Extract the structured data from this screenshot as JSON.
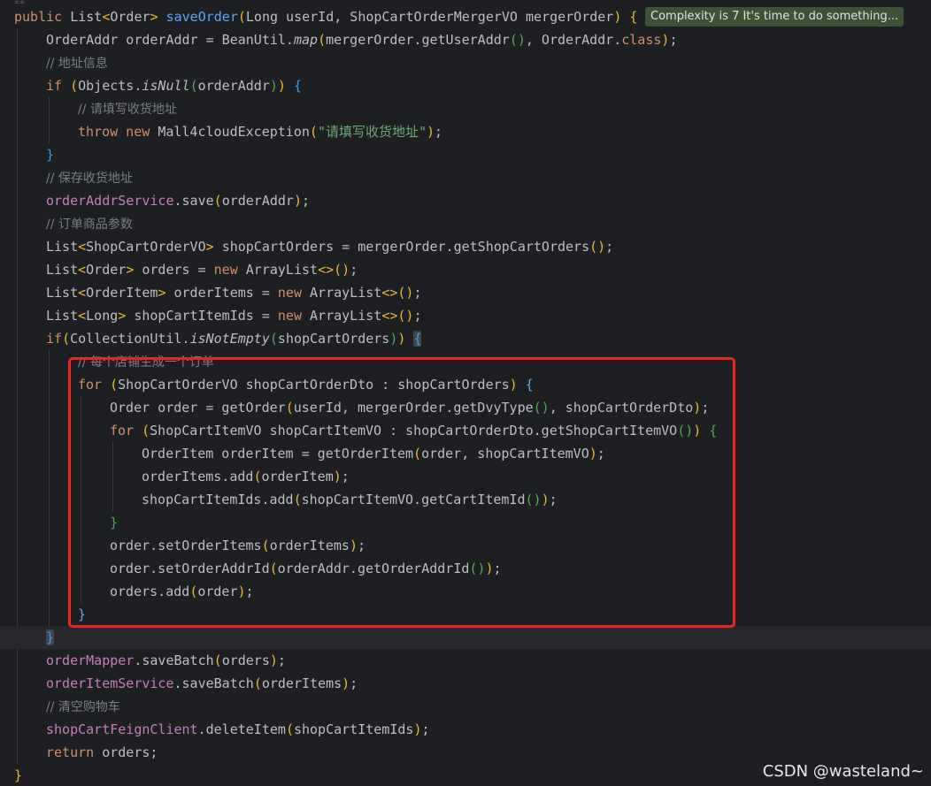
{
  "editor": {
    "top_glyph": "⁂",
    "complexity_hint": "Complexity is 7 It's time to do something...",
    "watermark": "CSDN @wasteland~",
    "highlight_color": "#e8261f",
    "lines": [
      {
        "indent": 0,
        "tokens": [
          [
            "kw",
            "public "
          ],
          [
            "",
            "List"
          ],
          [
            "b1",
            "<"
          ],
          [
            "",
            "Order"
          ],
          [
            "b1",
            "> "
          ],
          [
            "fn",
            "saveOrder"
          ],
          [
            "b1",
            "("
          ],
          [
            "",
            "Long userId, ShopCartOrderMergerVO mergerOrder"
          ],
          [
            "b1",
            ") {"
          ]
        ]
      },
      {
        "indent": 1,
        "tokens": [
          [
            "",
            "OrderAddr orderAddr = BeanUtil."
          ],
          [
            "it",
            "map"
          ],
          [
            "b1",
            "("
          ],
          [
            "",
            "mergerOrder.getUserAddr"
          ],
          [
            "b2",
            "()"
          ],
          [
            "",
            ", OrderAddr."
          ],
          [
            "kw",
            "class"
          ],
          [
            "b1",
            ")"
          ],
          [
            "",
            ";"
          ]
        ]
      },
      {
        "indent": 1,
        "tokens": [
          [
            "cm",
            "// 地址信息"
          ]
        ]
      },
      {
        "indent": 1,
        "tokens": [
          [
            "kw",
            "if "
          ],
          [
            "b1",
            "("
          ],
          [
            "",
            "Objects."
          ],
          [
            "it",
            "isNull"
          ],
          [
            "b2",
            "("
          ],
          [
            "",
            "orderAddr"
          ],
          [
            "b2",
            ")"
          ],
          [
            "b1",
            ") "
          ],
          [
            "b3",
            "{"
          ]
        ]
      },
      {
        "indent": 2,
        "tokens": [
          [
            "cm",
            "// 请填写收货地址"
          ]
        ]
      },
      {
        "indent": 2,
        "tokens": [
          [
            "kw",
            "throw new "
          ],
          [
            "",
            "Mall4cloudException"
          ],
          [
            "b1",
            "("
          ],
          [
            "str",
            "\"请填写收货地址\""
          ],
          [
            "b1",
            ")"
          ],
          [
            "",
            ";"
          ]
        ]
      },
      {
        "indent": 1,
        "tokens": [
          [
            "b3",
            "}"
          ]
        ]
      },
      {
        "indent": 1,
        "tokens": [
          [
            "cm",
            "// 保存收货地址"
          ]
        ]
      },
      {
        "indent": 1,
        "tokens": [
          [
            "fld",
            "orderAddrService"
          ],
          [
            "",
            ".save"
          ],
          [
            "b1",
            "("
          ],
          [
            "",
            "orderAddr"
          ],
          [
            "b1",
            ")"
          ],
          [
            "",
            ";"
          ]
        ]
      },
      {
        "indent": 1,
        "tokens": [
          [
            "cm",
            "// 订单商品参数"
          ]
        ]
      },
      {
        "indent": 1,
        "tokens": [
          [
            "",
            "List"
          ],
          [
            "b1",
            "<"
          ],
          [
            "",
            "ShopCartOrderVO"
          ],
          [
            "b1",
            "> "
          ],
          [
            "",
            "shopCartOrders = mergerOrder.getShopCartOrders"
          ],
          [
            "b1",
            "()"
          ],
          [
            "",
            ";"
          ]
        ]
      },
      {
        "indent": 1,
        "tokens": [
          [
            "",
            "List"
          ],
          [
            "b1",
            "<"
          ],
          [
            "",
            "Order"
          ],
          [
            "b1",
            "> "
          ],
          [
            "",
            "orders = "
          ],
          [
            "kw",
            "new "
          ],
          [
            "",
            "ArrayList"
          ],
          [
            "b1",
            "<>()"
          ],
          [
            "",
            ";"
          ]
        ]
      },
      {
        "indent": 1,
        "tokens": [
          [
            "",
            "List"
          ],
          [
            "b1",
            "<"
          ],
          [
            "",
            "OrderItem"
          ],
          [
            "b1",
            "> "
          ],
          [
            "",
            "orderItems = "
          ],
          [
            "kw",
            "new "
          ],
          [
            "",
            "ArrayList"
          ],
          [
            "b1",
            "<>()"
          ],
          [
            "",
            ";"
          ]
        ]
      },
      {
        "indent": 1,
        "tokens": [
          [
            "",
            "List"
          ],
          [
            "b1",
            "<"
          ],
          [
            "",
            "Long"
          ],
          [
            "b1",
            "> "
          ],
          [
            "",
            "shopCartItemIds = "
          ],
          [
            "kw",
            "new "
          ],
          [
            "",
            "ArrayList"
          ],
          [
            "b1",
            "<>()"
          ],
          [
            "",
            ";"
          ]
        ]
      },
      {
        "indent": 1,
        "tokens": [
          [
            "kw",
            "if"
          ],
          [
            "b1",
            "("
          ],
          [
            "",
            "CollectionUtil."
          ],
          [
            "it",
            "isNotEmpty"
          ],
          [
            "b2",
            "("
          ],
          [
            "",
            "shopCartOrders"
          ],
          [
            "b2",
            ")"
          ],
          [
            "b1",
            ") "
          ],
          [
            "b3 match",
            "{"
          ]
        ]
      },
      {
        "indent": 2,
        "tokens": [
          [
            "cm",
            "// 每个店铺生成一个订单"
          ]
        ]
      },
      {
        "indent": 2,
        "tokens": [
          [
            "kw",
            "for "
          ],
          [
            "b1",
            "("
          ],
          [
            "",
            "ShopCartOrderVO shopCartOrderDto : shopCartOrders"
          ],
          [
            "b1",
            ") "
          ],
          [
            "b4",
            "{"
          ]
        ]
      },
      {
        "indent": 3,
        "tokens": [
          [
            "",
            "Order order = getOrder"
          ],
          [
            "b1",
            "("
          ],
          [
            "",
            "userId, mergerOrder.getDvyType"
          ],
          [
            "b2",
            "()"
          ],
          [
            "",
            ", shopCartOrderDto"
          ],
          [
            "b1",
            ")"
          ],
          [
            "",
            ";"
          ]
        ]
      },
      {
        "indent": 3,
        "tokens": [
          [
            "kw",
            "for "
          ],
          [
            "b1",
            "("
          ],
          [
            "",
            "ShopCartItemVO shopCartItemVO : shopCartOrderDto.getShopCartItemVO"
          ],
          [
            "b2",
            "()"
          ],
          [
            "b1",
            ") "
          ],
          [
            "b2",
            "{"
          ]
        ]
      },
      {
        "indent": 4,
        "tokens": [
          [
            "",
            "OrderItem orderItem = getOrderItem"
          ],
          [
            "b1",
            "("
          ],
          [
            "",
            "order, shopCartItemVO"
          ],
          [
            "b1",
            ")"
          ],
          [
            "",
            ";"
          ]
        ]
      },
      {
        "indent": 4,
        "tokens": [
          [
            "",
            "orderItems.add"
          ],
          [
            "b1",
            "("
          ],
          [
            "",
            "orderItem"
          ],
          [
            "b1",
            ")"
          ],
          [
            "",
            ";"
          ]
        ]
      },
      {
        "indent": 4,
        "tokens": [
          [
            "",
            "shopCartItemIds.add"
          ],
          [
            "b1",
            "("
          ],
          [
            "",
            "shopCartItemVO.getCartItemId"
          ],
          [
            "b2",
            "()"
          ],
          [
            "b1",
            ")"
          ],
          [
            "",
            ";"
          ]
        ]
      },
      {
        "indent": 3,
        "tokens": [
          [
            "b2",
            "}"
          ]
        ]
      },
      {
        "indent": 3,
        "tokens": [
          [
            "",
            "order.setOrderItems"
          ],
          [
            "b1",
            "("
          ],
          [
            "",
            "orderItems"
          ],
          [
            "b1",
            ")"
          ],
          [
            "",
            ";"
          ]
        ]
      },
      {
        "indent": 3,
        "tokens": [
          [
            "",
            "order.setOrderAddrId"
          ],
          [
            "b1",
            "("
          ],
          [
            "",
            "orderAddr.getOrderAddrId"
          ],
          [
            "b2",
            "()"
          ],
          [
            "b1",
            ")"
          ],
          [
            "",
            ";"
          ]
        ]
      },
      {
        "indent": 3,
        "tokens": [
          [
            "",
            "orders.add"
          ],
          [
            "b1",
            "("
          ],
          [
            "",
            "order"
          ],
          [
            "b1",
            ")"
          ],
          [
            "",
            ";"
          ]
        ]
      },
      {
        "indent": 2,
        "tokens": [
          [
            "b4",
            "}"
          ]
        ]
      },
      {
        "indent": 1,
        "tokens": [
          [
            "b3 match",
            "}"
          ]
        ],
        "current": true
      },
      {
        "indent": 1,
        "tokens": [
          [
            "fld",
            "orderMapper"
          ],
          [
            "",
            ".saveBatch"
          ],
          [
            "b1",
            "("
          ],
          [
            "",
            "orders"
          ],
          [
            "b1",
            ")"
          ],
          [
            "",
            ";"
          ]
        ]
      },
      {
        "indent": 1,
        "tokens": [
          [
            "fld",
            "orderItemService"
          ],
          [
            "",
            ".saveBatch"
          ],
          [
            "b1",
            "("
          ],
          [
            "",
            "orderItems"
          ],
          [
            "b1",
            ")"
          ],
          [
            "",
            ";"
          ]
        ]
      },
      {
        "indent": 1,
        "tokens": [
          [
            "cm",
            "// 清空购物车"
          ]
        ]
      },
      {
        "indent": 1,
        "tokens": [
          [
            "fld",
            "shopCartFeignClient"
          ],
          [
            "",
            ".deleteItem"
          ],
          [
            "b1",
            "("
          ],
          [
            "",
            "shopCartItemIds"
          ],
          [
            "b1",
            ")"
          ],
          [
            "",
            ";"
          ]
        ]
      },
      {
        "indent": 1,
        "tokens": [
          [
            "kw",
            "return "
          ],
          [
            "",
            "orders;"
          ]
        ]
      },
      {
        "indent": 0,
        "tokens": [
          [
            "b1",
            "}"
          ]
        ]
      }
    ]
  }
}
